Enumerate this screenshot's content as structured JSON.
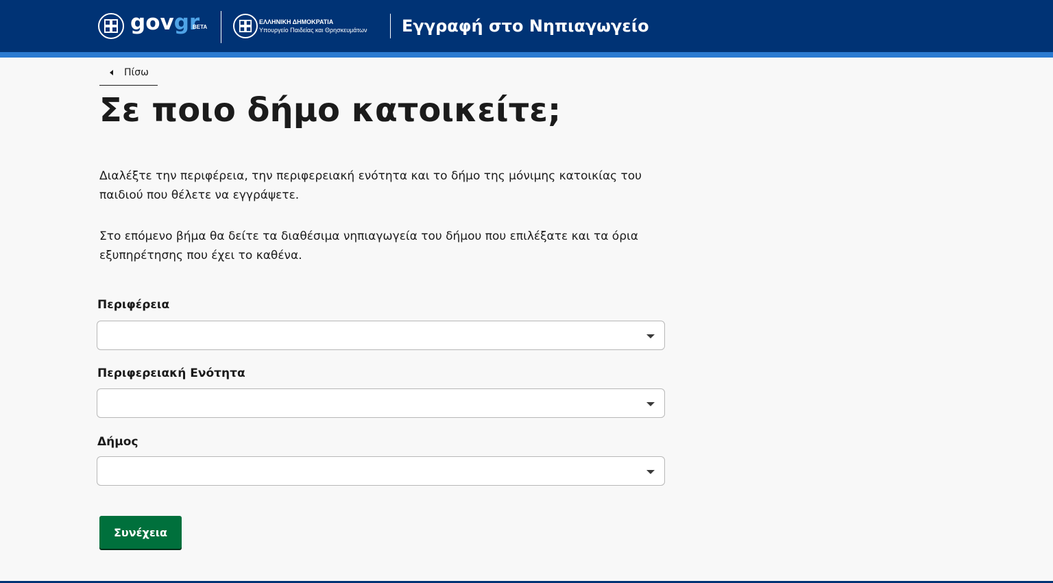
{
  "header": {
    "logo_main": "gov",
    "logo_accent": "gr",
    "logo_badge": "BETA",
    "ministry_line1": "ΕΛΛΗΝΙΚΗ ΔΗΜΟΚΡΑΤΙΑ",
    "ministry_line2": "Υπουργείο Παιδείας και Θρησκευμάτων",
    "service_title": "Εγγραφή στο Νηπιαγωγείο"
  },
  "nav": {
    "back_label": "Πίσω"
  },
  "main": {
    "title": "Σε ποιο δήμο κατοικείτε;",
    "paragraph1": "Διαλέξτε την περιφέρεια, την περιφερειακή ενότητα και το δήμο της μόνιμης κατοικίας του παιδιού που θέλετε να εγγράψετε.",
    "paragraph2": "Στο επόμενο βήμα θα δείτε τα διαθέσιμα νηπιαγωγεία του δήμου που επιλέξατε και τα όρια εξυπηρέτησης που έχει το καθένα.",
    "fields": [
      {
        "label": "Περιφέρεια",
        "value": ""
      },
      {
        "label": "Περιφερειακή Ενότητα",
        "value": ""
      },
      {
        "label": "Δήμος",
        "value": ""
      }
    ],
    "continue_label": "Συνέχεια"
  },
  "colors": {
    "header_bg": "#003375",
    "header_stripe": "#2a7ad1",
    "button_bg": "#00703c",
    "logo_accent": "#4fa3e6"
  },
  "icons": [
    "greek-emblem-icon",
    "chevron-left-icon",
    "caret-down-icon"
  ]
}
